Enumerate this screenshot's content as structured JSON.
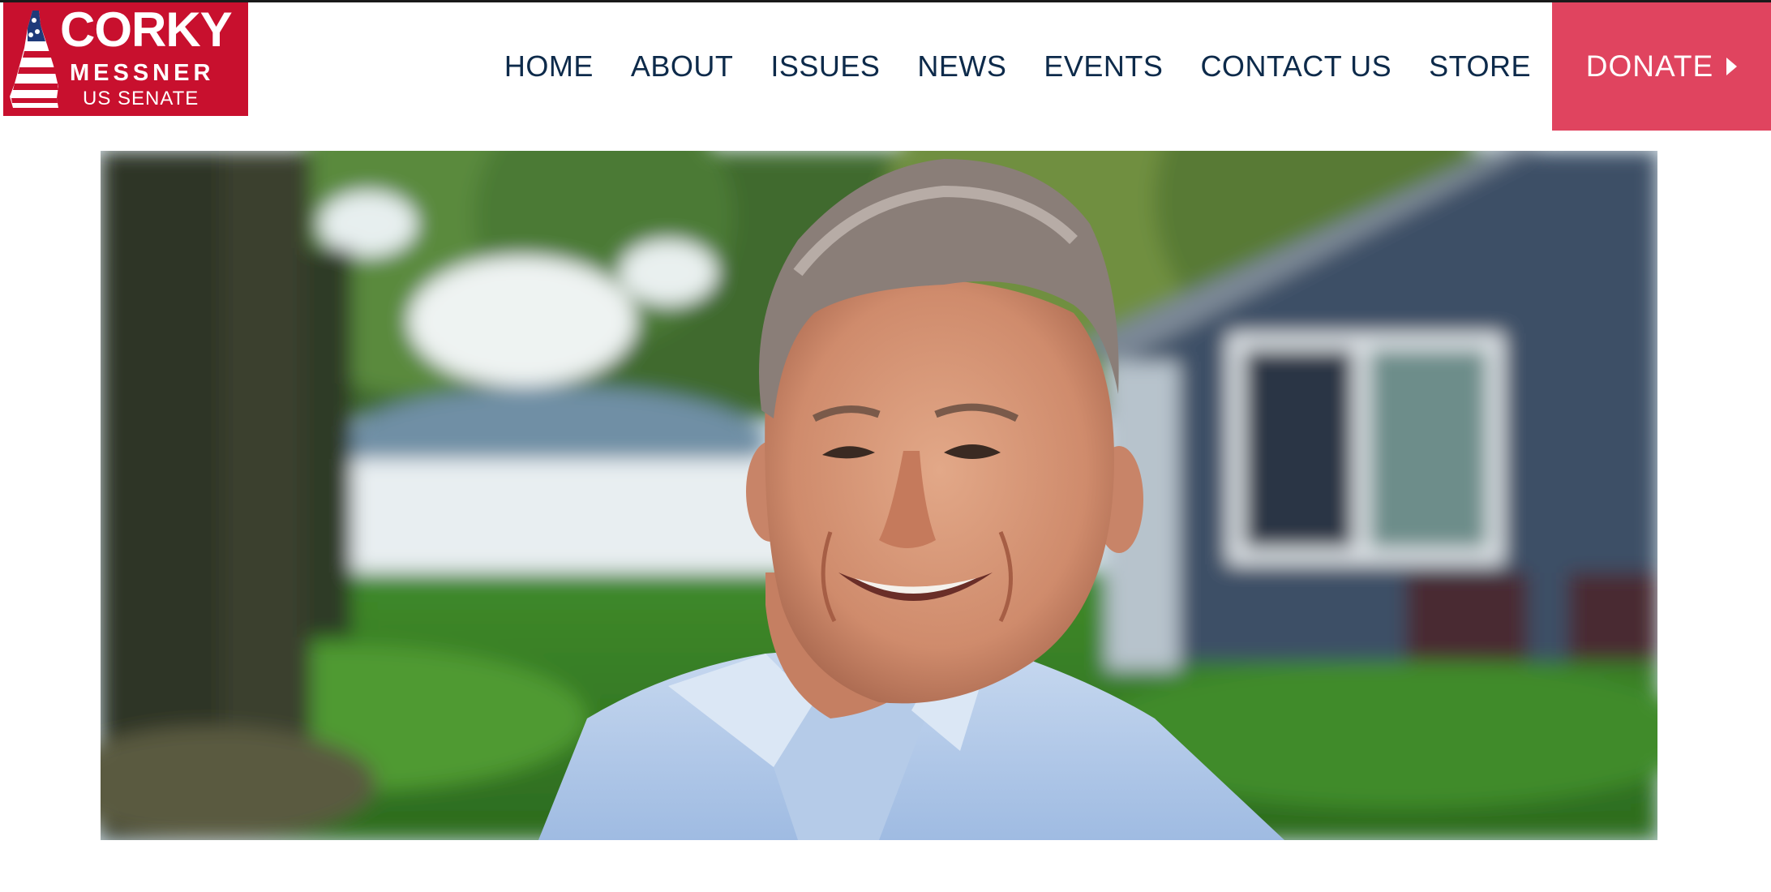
{
  "brand": {
    "name_line1": "CORKY",
    "name_line2": "MESSNER",
    "name_line3": "US SENATE",
    "color": "#c8102e"
  },
  "nav": {
    "items": [
      {
        "label": "HOME"
      },
      {
        "label": "ABOUT"
      },
      {
        "label": "ISSUES"
      },
      {
        "label": "NEWS"
      },
      {
        "label": "EVENTS"
      },
      {
        "label": "CONTACT US"
      },
      {
        "label": "STORE"
      }
    ],
    "donate_label": "DONATE",
    "donate_color": "#e0445f",
    "text_color": "#0d2a4a"
  },
  "hero": {
    "icon": "candidate-portrait-photo"
  }
}
